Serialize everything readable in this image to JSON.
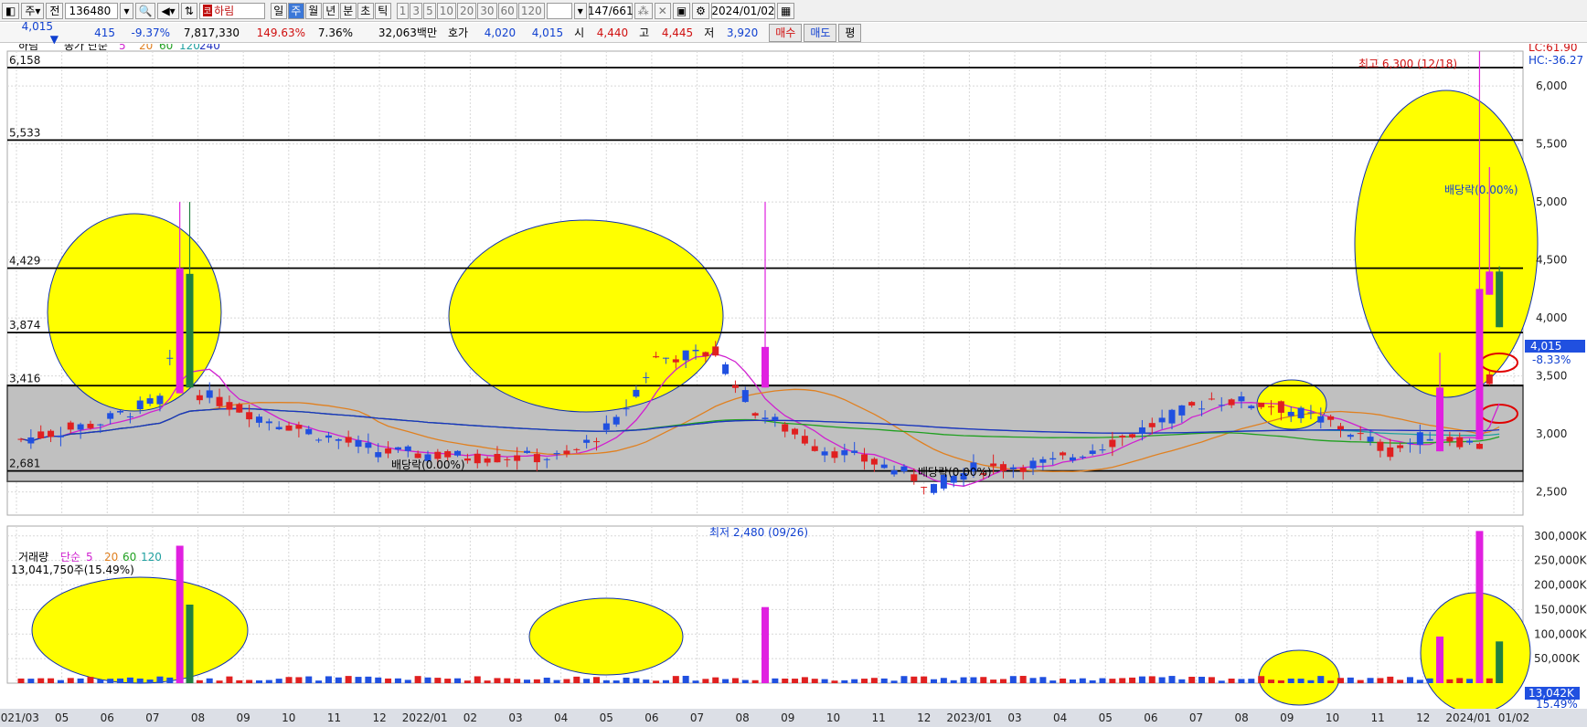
{
  "toolbar": {
    "market": "주",
    "type": "전",
    "code": "136480",
    "name": "하림",
    "periods": [
      "일",
      "주",
      "월",
      "년",
      "분",
      "초",
      "틱"
    ],
    "selected_period": "주",
    "intervals": [
      "1",
      "3",
      "5",
      "10",
      "20",
      "30",
      "60",
      "120"
    ],
    "count": "147/661",
    "date": "2024/01/02"
  },
  "quote": {
    "price": "4,015",
    "change": "415",
    "change_pct": "-9.37%",
    "volume": "7,817,330",
    "volume_ratio": "149.63%",
    "turnover_pct": "7.36%",
    "amount": "32,063백만",
    "bid_label": "호가",
    "bid": "4,020",
    "ask": "4,015",
    "open_label": "시",
    "open": "4,440",
    "high_label": "고",
    "high": "4,445",
    "low_label": "저",
    "low": "3,920",
    "buy_label": "매수",
    "sell_label": "매도",
    "eval_label": "평"
  },
  "price_panel": {
    "name": "하림",
    "legend_label": "종가 단순",
    "ma_periods": [
      "5",
      "20",
      "60",
      "120",
      "240"
    ],
    "ma_colors": [
      "#d020d0",
      "#e08020",
      "#20a020",
      "#20a0a0",
      "#2030c0"
    ],
    "lc_label": "LC:61.90",
    "hc_label": "HC:-36.27",
    "current_price_label": "4,015",
    "current_pct_label": "-8.33%",
    "high_note": "최고 6,300 (12/18)",
    "low_note": "최저 2,480 (09/26)",
    "dividend_note": "배당락(0.00%)"
  },
  "volume_panel": {
    "label": "거래량",
    "legend_label": "단순",
    "ma_periods": [
      "5",
      "20",
      "60",
      "120"
    ],
    "current_volume": "13,041,750주(15.49%)",
    "current_volume_tag": "13,042K",
    "current_volume_pct": "15.49%"
  },
  "chart_data": {
    "type": "candlestick",
    "price_axis": {
      "min": 2300,
      "max": 6300,
      "ticks": [
        "2,500",
        "3,000",
        "3,500",
        "4,000",
        "4,500",
        "5,000",
        "5,500",
        "6,000"
      ]
    },
    "volume_axis": {
      "min": 0,
      "max": 320000,
      "ticks": [
        "50,000K",
        "100,000K",
        "150,000K",
        "200,000K",
        "250,000K",
        "300,000K"
      ]
    },
    "x_labels": [
      "2021/03",
      "05",
      "06",
      "07",
      "08",
      "09",
      "10",
      "11",
      "12",
      "2022/01",
      "02",
      "03",
      "04",
      "05",
      "06",
      "07",
      "08",
      "09",
      "10",
      "11",
      "12",
      "2023/01",
      "03",
      "04",
      "05",
      "06",
      "07",
      "08",
      "09",
      "10",
      "11",
      "12",
      "2024/01",
      "01/02"
    ],
    "hlines": [
      {
        "label": "6,158",
        "value": 6158
      },
      {
        "label": "5,533",
        "value": 5533
      },
      {
        "label": "4,429",
        "value": 4429
      },
      {
        "label": "3,874",
        "value": 3874
      },
      {
        "label": "3,416",
        "value": 3416
      },
      {
        "label": "2,681",
        "value": 2681
      }
    ],
    "shaded_band": [
      2590,
      3420
    ]
  }
}
